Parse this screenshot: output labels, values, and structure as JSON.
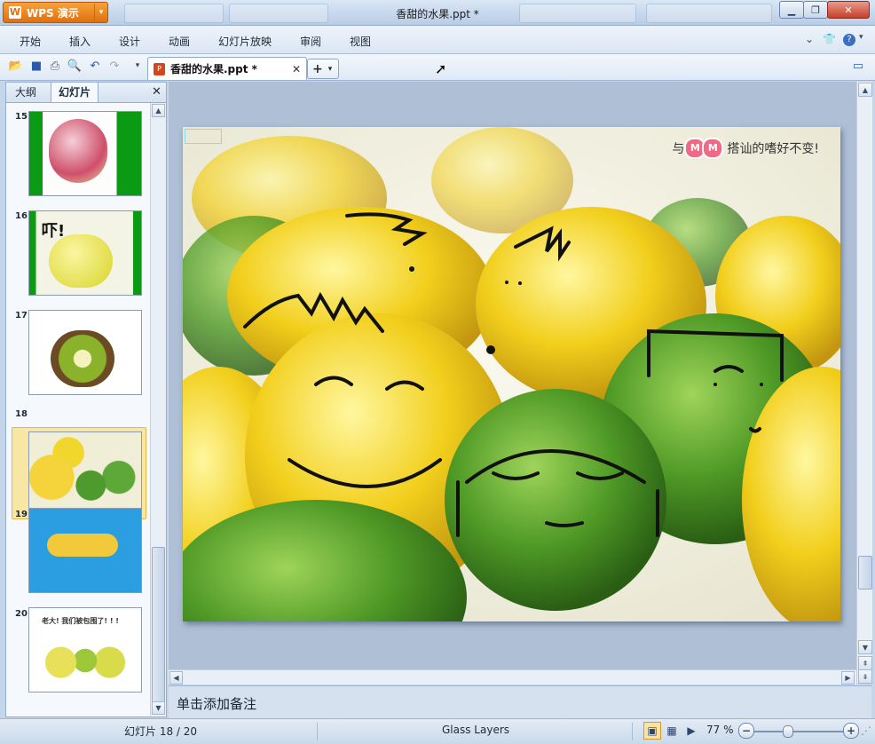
{
  "app": {
    "button_label": "WPS 演示",
    "window_title": "香甜的水果.ppt *"
  },
  "menu": {
    "items": [
      "开始",
      "插入",
      "设计",
      "动画",
      "幻灯片放映",
      "审阅",
      "视图"
    ]
  },
  "toolbar": {
    "doc_tab_name": "香甜的水果.ppt *",
    "icons": [
      "open-icon",
      "save-icon",
      "print-icon",
      "print-preview-icon",
      "undo-icon",
      "redo-icon",
      "customize-dropdown-icon"
    ]
  },
  "left_pane": {
    "tabs": [
      "大纲",
      "幻灯片"
    ],
    "active_tab": "幻灯片",
    "slides": [
      {
        "number": "15",
        "text": ""
      },
      {
        "number": "16",
        "text": "吓!"
      },
      {
        "number": "17",
        "text": ""
      },
      {
        "number": "18",
        "text": "",
        "selected": true
      },
      {
        "number": "19",
        "text": ""
      },
      {
        "number": "20",
        "text": "老大! 我们被包围了! ! !"
      }
    ]
  },
  "slide": {
    "caption_prefix": "与",
    "caption_suffix": "搭讪的嗜好不变!",
    "mm_letters": [
      "M",
      "M"
    ]
  },
  "notes": {
    "placeholder": "单击添加备注"
  },
  "status": {
    "slide_counter": "幻灯片 18 / 20",
    "theme": "Glass Layers",
    "zoom": "77 %"
  },
  "colors": {
    "accent_orange": "#e0700e",
    "selection_yellow": "#f8e6a4",
    "frame_blue": "#aebfd6"
  }
}
